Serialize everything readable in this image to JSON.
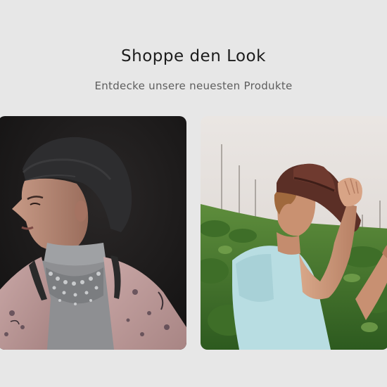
{
  "section": {
    "title": "Shoppe den Look",
    "subtitle": "Entdecke unsere neuesten Produkte"
  },
  "products": [
    {
      "image": "woman-beanie-necklace-photo"
    },
    {
      "image": "man-hat-field-photo"
    }
  ]
}
